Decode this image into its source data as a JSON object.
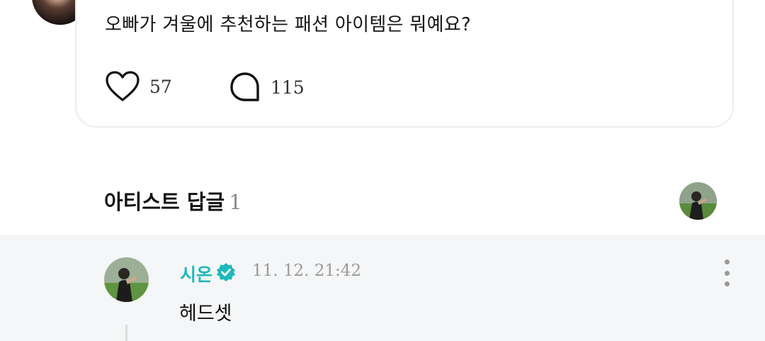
{
  "post": {
    "question": "오빠가 겨울에 추천하는 패션 아이템은 뭐예요?",
    "like_count": "57",
    "comment_count": "115"
  },
  "artist_replies": {
    "title": "아티스트 답글",
    "count": "1"
  },
  "reply": {
    "author": "시온",
    "timestamp": "11. 12. 21:42",
    "text": "헤드셋"
  },
  "colors": {
    "accent": "#1fb9bc",
    "reply_background": "#f5f6f7",
    "muted_text": "#9a9a9a"
  }
}
